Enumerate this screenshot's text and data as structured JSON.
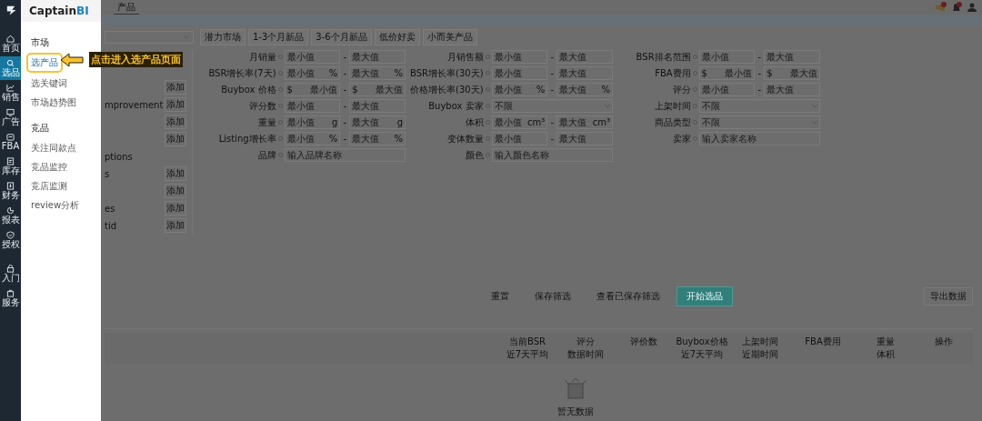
{
  "nav": {
    "items": [
      {
        "label": "首页",
        "selected": false
      },
      {
        "label": "选品",
        "selected": true
      },
      {
        "label": "销售",
        "selected": false
      },
      {
        "label": "广告",
        "selected": false
      },
      {
        "label": "FBA",
        "selected": false
      },
      {
        "label": "库存",
        "selected": false
      },
      {
        "label": "财务",
        "selected": false
      },
      {
        "label": "报表",
        "selected": false
      },
      {
        "label": "授权",
        "selected": false
      },
      {
        "label": "入门",
        "selected": false
      },
      {
        "label": "服务",
        "selected": false
      }
    ]
  },
  "menu": {
    "brand": "Captain",
    "brand_accent": "BI",
    "sections": [
      {
        "title": "市场",
        "items": [
          {
            "label": "选产品",
            "selected": true
          },
          {
            "label": "选关键词",
            "selected": false
          },
          {
            "label": "市场趋势图",
            "selected": false
          }
        ]
      },
      {
        "title": "竞品",
        "items": [
          {
            "label": "关注同款点",
            "selected": false
          },
          {
            "label": "竞品监控",
            "selected": false
          },
          {
            "label": "竞店监测",
            "selected": false
          },
          {
            "label": "review分析",
            "selected": false
          }
        ]
      }
    ]
  },
  "callout": {
    "text": "点击进入选产品页面"
  },
  "tabs": [
    {
      "label": "产品",
      "selected": true
    }
  ],
  "toolbar": {
    "buttons": [
      "潜力市场",
      "1-3个月新品",
      "3-6个月新品",
      "低价好卖",
      "小而美产品"
    ]
  },
  "categories": [
    {
      "tag": "添加"
    },
    {
      "name": "mprovement",
      "tag": "添加"
    },
    {
      "tag": "添加"
    },
    {
      "tag": "添加"
    },
    {
      "name": "ptions"
    },
    {
      "name": "s",
      "tag": "添加"
    },
    {
      "tag": "添加"
    },
    {
      "name": "es",
      "tag": "添加"
    },
    {
      "name": "tid",
      "tag": "添加"
    }
  ],
  "filters": [
    [
      {
        "kind": "range",
        "label": "月销量",
        "min": "最小值",
        "separator": "-",
        "max": "最大值"
      },
      {
        "kind": "range",
        "label": "BSR增长率(7天)",
        "min": "最小值",
        "min_suffix": "%",
        "separator": "-",
        "max": "最大值",
        "max_suffix": "%"
      },
      {
        "kind": "range",
        "label": "Buybox 价格",
        "min_prefix": "$",
        "min": "最小值",
        "separator": "-",
        "max_prefix": "$",
        "max": "最大值"
      },
      {
        "kind": "range",
        "label": "评分数",
        "min": "最小值",
        "separator": "-",
        "max": "最大值"
      },
      {
        "kind": "range",
        "label": "重量",
        "min": "最小值",
        "min_suffix": "g",
        "separator": "-",
        "max": "最大值",
        "max_suffix": "g"
      },
      {
        "kind": "range",
        "label": "Listing增长率",
        "min": "最小值",
        "min_suffix": "%",
        "separator": "-",
        "max": "最大值",
        "max_suffix": "%"
      },
      {
        "kind": "text",
        "label": "品牌",
        "placeholder": "输入品牌名称"
      }
    ],
    [
      {
        "kind": "range",
        "label": "月销售额",
        "min": "最小值",
        "separator": "-",
        "max": "最大值"
      },
      {
        "kind": "range",
        "label": "BSR增长率(30天)",
        "min": "最小值",
        "separator": "-",
        "max": "最大值"
      },
      {
        "kind": "range",
        "label": "价格增长率(30天)",
        "min": "最小值",
        "min_suffix": "%",
        "separator": "-",
        "max": "最大值",
        "max_suffix": "%"
      },
      {
        "kind": "select",
        "label": "Buybox 卖家",
        "value": "不限"
      },
      {
        "kind": "range",
        "label": "体积",
        "min": "最小值",
        "min_suffix": "cm³",
        "separator": "-",
        "max": "最大值",
        "max_suffix": "cm³"
      },
      {
        "kind": "range",
        "label": "变体数量",
        "min": "最小值",
        "separator": "-",
        "max": "最大值"
      },
      {
        "kind": "text",
        "label": "颜色",
        "placeholder": "输入颜色名称"
      }
    ],
    [
      {
        "kind": "range",
        "label": "BSR排名范围",
        "min": "最小值",
        "separator": "-",
        "max": "最大值"
      },
      {
        "kind": "range",
        "label": "FBA费用",
        "min_prefix": "$",
        "min": "最小值",
        "separator": "-",
        "max_prefix": "$",
        "max": "最大值"
      },
      {
        "kind": "range",
        "label": "评分",
        "min": "最小值",
        "separator": "-",
        "max": "最大值"
      },
      {
        "kind": "select",
        "label": "上架时间",
        "value": "不限"
      },
      {
        "kind": "select",
        "label": "商品类型",
        "value": "不限"
      },
      {
        "kind": "text",
        "label": "卖家",
        "placeholder": "输入卖家名称"
      }
    ]
  ],
  "actions": [
    {
      "label": "重置",
      "kind": "plain"
    },
    {
      "label": "保存筛选",
      "kind": "plain"
    },
    {
      "label": "查看已保存筛选",
      "kind": "plain"
    },
    {
      "label": "开始选品",
      "kind": "primary"
    }
  ],
  "export": "导出数据",
  "table": {
    "columns": [
      {
        "title": "当前BSR",
        "sub": "近7天平均"
      },
      {
        "title": "评分",
        "sub": "数据时间"
      },
      {
        "title": "评价数"
      },
      {
        "title": "Buybox价格",
        "sub": "近7天平均"
      },
      {
        "title": "上架时间",
        "sub": "近期时间"
      },
      {
        "title": "FBA费用"
      },
      {
        "title": "重量",
        "sub": "体积"
      },
      {
        "title": "操作"
      }
    ]
  },
  "empty": "暂无数据"
}
